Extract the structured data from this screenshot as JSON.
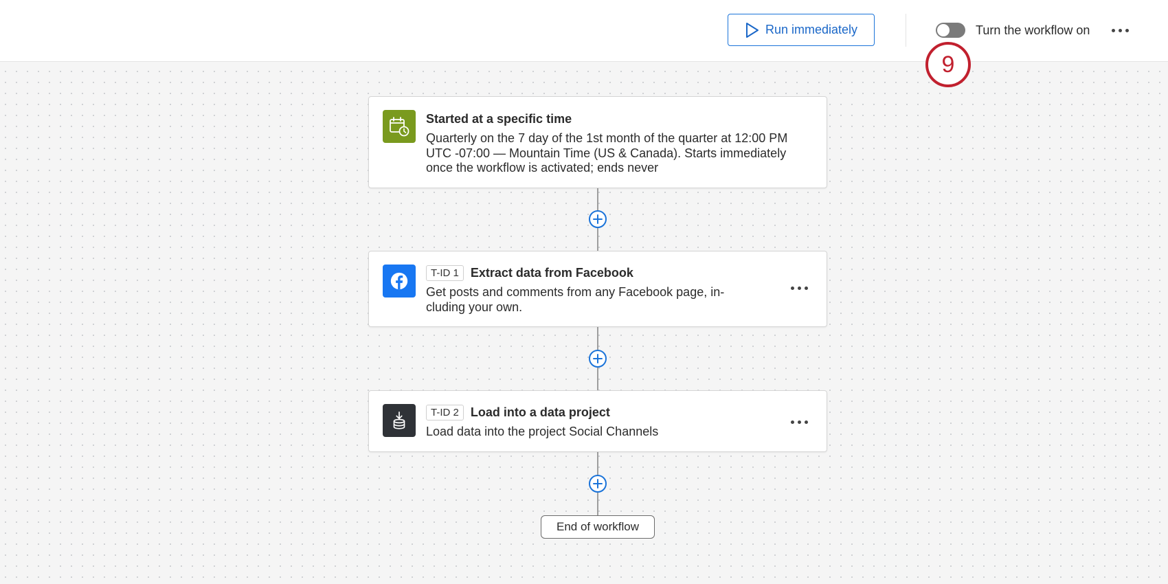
{
  "header": {
    "run_label": "Run immediately",
    "toggle_label": "Turn the workflow on",
    "toggle_state": "off"
  },
  "callout": {
    "number": "9",
    "color": "#c1202e"
  },
  "trigger": {
    "title": "Started at a specific time",
    "desc_lines": [
      "Quarterly on the 7 day of the 1st month of the quarter at 12:00 PM",
      "UTC -07:00 — Mountain Time (US & Canada). Starts immediately",
      "once the workflow is activated; ends never"
    ],
    "icon": "calendar-clock-icon",
    "icon_color": "#7a9a1e"
  },
  "tasks": [
    {
      "tid": "T-ID 1",
      "title": "Extract data from Facebook",
      "desc_lines": [
        "Get posts and comments from any Facebook page, in-",
        "cluding your own."
      ],
      "icon": "facebook-icon",
      "icon_color": "#1877f2"
    },
    {
      "tid": "T-ID 2",
      "title": "Load into a data project",
      "desc_lines": [
        "Load data into the project Social Channels"
      ],
      "icon": "database-load-icon",
      "icon_color": "#2f3237"
    }
  ],
  "end_label": "End of workflow",
  "colors": {
    "accent": "#1a73d9",
    "canvas": "#f5f5f5"
  }
}
